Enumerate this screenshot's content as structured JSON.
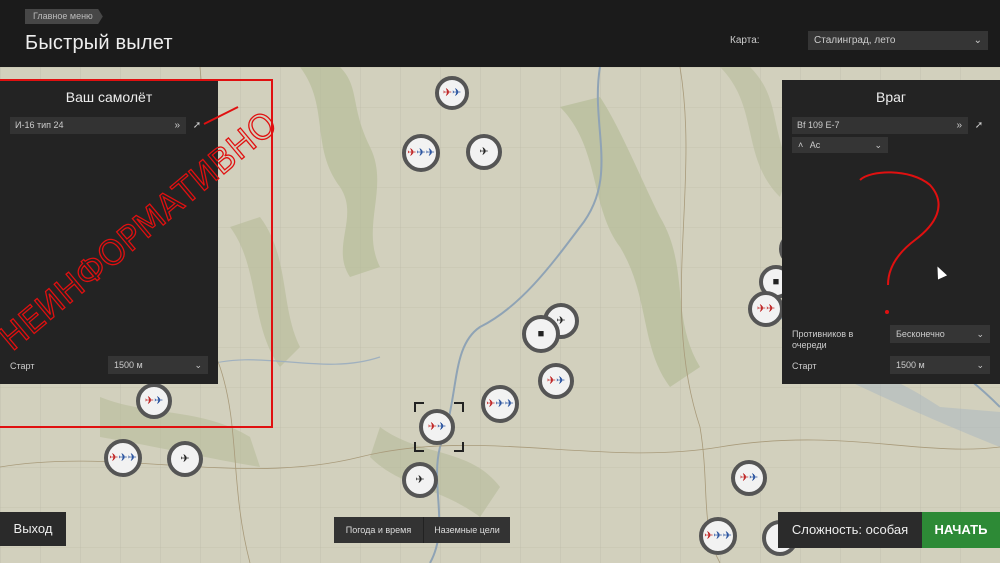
{
  "header": {
    "breadcrumb": "Главное меню",
    "title": "Быстрый вылет",
    "map_label": "Карта:",
    "map_value": "Сталинград, лето"
  },
  "left_panel": {
    "title": "Ваш самолёт",
    "aircraft": "И-16 тип 24",
    "start_label": "Старт",
    "start_value": "1500 м"
  },
  "right_panel": {
    "title": "Враг",
    "aircraft": "Bf 109 E-7",
    "skill": "Ас",
    "enemies_queue_label_line1": "Противников в",
    "enemies_queue_label_line2": "очереди",
    "enemies_queue_value": "Бесконечно",
    "start_label": "Старт",
    "start_value": "1500 м"
  },
  "annotation": {
    "handwritten_text": "НЕИНФОРМАТИВНО",
    "question_mark": "?"
  },
  "bottom": {
    "exit_label": "Выход",
    "weather_label": "Погода и время",
    "ground_targets_label": "Наземные цели",
    "difficulty_label": "Сложность: особая",
    "start_label": "НАЧАТЬ"
  },
  "colors": {
    "header_bg": "#1b1b1b",
    "panel_bg": "#232323",
    "start_button": "#2d8a36",
    "annotation_red": "#e01010"
  },
  "icons": {
    "chevron": "chevron-down-icon",
    "double_arrow": "double-arrow-icon",
    "pin": "pin-icon",
    "aircraft_marker": "aircraft-icon",
    "tank_marker": "tank-icon"
  }
}
